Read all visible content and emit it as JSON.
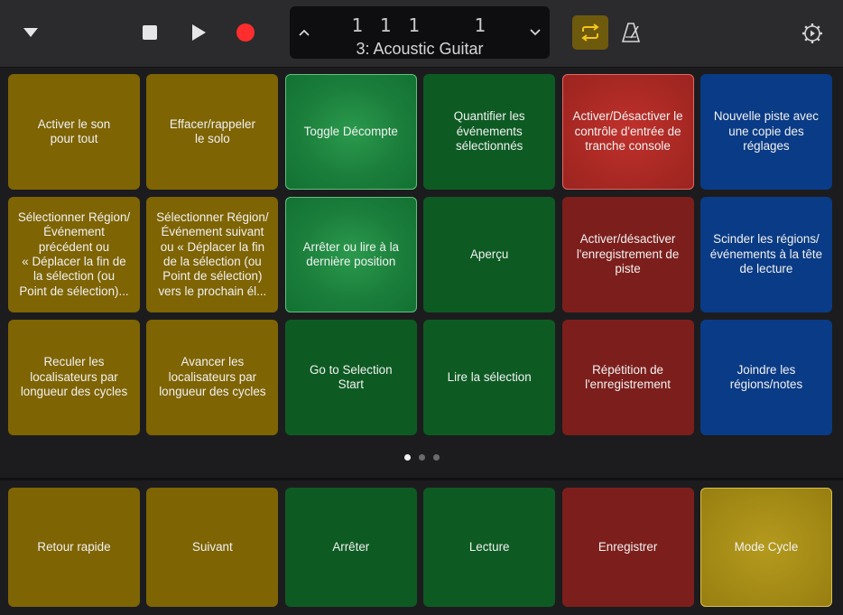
{
  "transport": {
    "position": "1  1  1       1",
    "track_name": "3: Acoustic Guitar"
  },
  "colors": {
    "gold": "#7e6403",
    "green": "#0d5b23",
    "red": "#7c1f1c",
    "blue": "#0a3b86",
    "cycle_active": "#f5c518",
    "record": "#ff3b30"
  },
  "icons": {
    "menu": "triangle-down",
    "stop": "square",
    "play": "triangle-right",
    "record": "circle",
    "cycle": "loop-arrows",
    "metronome": "metronome",
    "settings": "gear"
  },
  "pads": [
    {
      "label": "Activer le son\npour tout",
      "color": "gold"
    },
    {
      "label": "Effacer/rappeler\nle solo",
      "color": "gold"
    },
    {
      "label": "Toggle Décompte",
      "color": "green",
      "active": true
    },
    {
      "label": "Quantifier les\névénements\nsélectionnés",
      "color": "green"
    },
    {
      "label": "Activer/Désactiver le\ncontrôle d'entrée de\ntranche console",
      "color": "red",
      "active": true
    },
    {
      "label": "Nouvelle piste avec\nune copie des\nréglages",
      "color": "blue"
    },
    {
      "label": "Sélectionner Région/\nÉvénement\nprécédent ou\n« Déplacer la fin de\nla sélection (ou\nPoint de sélection)...",
      "color": "gold"
    },
    {
      "label": "Sélectionner Région/\nÉvénement suivant\nou « Déplacer la fin\nde la sélection (ou\nPoint de sélection)\nvers le prochain él...",
      "color": "gold"
    },
    {
      "label": "Arrêter ou lire à la\ndernière position",
      "color": "green",
      "active": true
    },
    {
      "label": "Aperçu",
      "color": "green"
    },
    {
      "label": "Activer/désactiver\nl'enregistrement de\npiste",
      "color": "red"
    },
    {
      "label": "Scinder les régions/\névénements à la tête\nde lecture",
      "color": "blue"
    },
    {
      "label": "Reculer les\nlocalisateurs par\nlongueur des cycles",
      "color": "gold"
    },
    {
      "label": "Avancer les\nlocalisateurs par\nlongueur des cycles",
      "color": "gold"
    },
    {
      "label": "Go to Selection\nStart",
      "color": "green"
    },
    {
      "label": "Lire la sélection",
      "color": "green"
    },
    {
      "label": "Répétition de\nl'enregistrement",
      "color": "red"
    },
    {
      "label": "Joindre les\nrégions/notes",
      "color": "blue"
    }
  ],
  "page_indicator": {
    "count": 3,
    "current": 1
  },
  "bottom_pads": [
    {
      "label": "Retour rapide",
      "color": "gold"
    },
    {
      "label": "Suivant",
      "color": "gold"
    },
    {
      "label": "Arrêter",
      "color": "green"
    },
    {
      "label": "Lecture",
      "color": "green"
    },
    {
      "label": "Enregistrer",
      "color": "red"
    },
    {
      "label": "Mode Cycle",
      "color": "gold",
      "active": true
    }
  ]
}
